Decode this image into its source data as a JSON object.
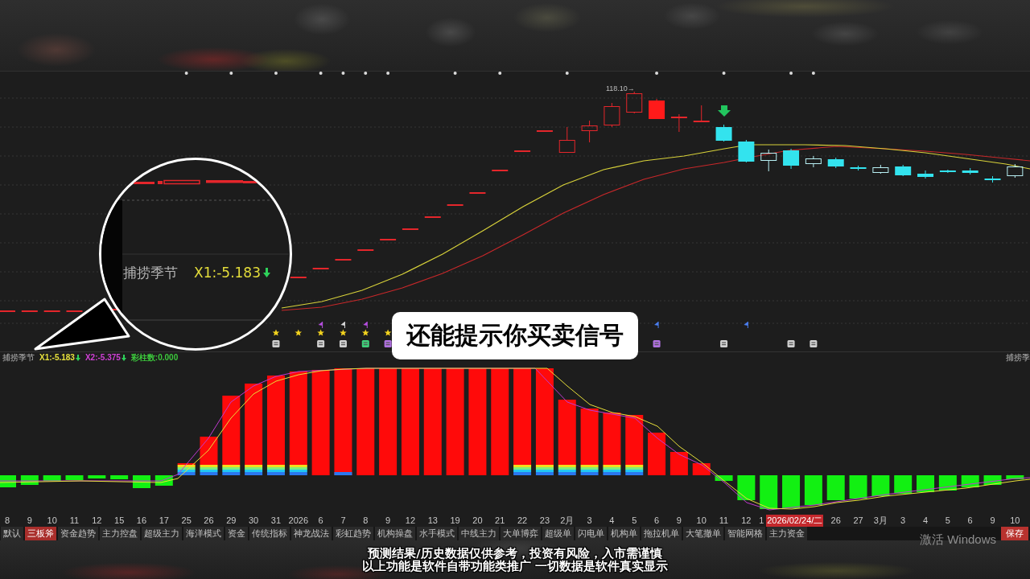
{
  "price_chart": {
    "high_label": "118.10→"
  },
  "magnifier": {
    "indicator_name": "捕捞季节",
    "x1_reading": "X1:-5.183"
  },
  "callout": {
    "text": "还能提示你买卖信号"
  },
  "indicator_bar": {
    "name": "捕捞季节",
    "readings": [
      {
        "text": "X1:-5.183",
        "color": "#e6e03c",
        "arrow": true
      },
      {
        "text": "X2:-5.375",
        "color": "#d040d6",
        "arrow": true
      },
      {
        "text": "彩柱数:0.000",
        "color": "#3cc83c",
        "arrow": false
      }
    ],
    "right_label": "捕捞季"
  },
  "date_axis": [
    {
      "label": "8",
      "kind": "date"
    },
    {
      "label": "9",
      "kind": "date"
    },
    {
      "label": "10",
      "kind": "date"
    },
    {
      "label": "11",
      "kind": "date"
    },
    {
      "label": "12",
      "kind": "date"
    },
    {
      "label": "15",
      "kind": "date"
    },
    {
      "label": "16",
      "kind": "date"
    },
    {
      "label": "17",
      "kind": "date"
    },
    {
      "label": "25",
      "kind": "date"
    },
    {
      "label": "26",
      "kind": "date"
    },
    {
      "label": "29",
      "kind": "date"
    },
    {
      "label": "30",
      "kind": "date"
    },
    {
      "label": "31",
      "kind": "date"
    },
    {
      "label": "2026",
      "kind": "date"
    },
    {
      "label": "6",
      "kind": "date"
    },
    {
      "label": "7",
      "kind": "date"
    },
    {
      "label": "8",
      "kind": "date"
    },
    {
      "label": "9",
      "kind": "date"
    },
    {
      "label": "12",
      "kind": "date"
    },
    {
      "label": "13",
      "kind": "date"
    },
    {
      "label": "19",
      "kind": "date"
    },
    {
      "label": "20",
      "kind": "date"
    },
    {
      "label": "21",
      "kind": "date"
    },
    {
      "label": "22",
      "kind": "date"
    },
    {
      "label": "23",
      "kind": "date"
    },
    {
      "label": "2月",
      "kind": "date"
    },
    {
      "label": "3",
      "kind": "date"
    },
    {
      "label": "4",
      "kind": "date"
    },
    {
      "label": "5",
      "kind": "date"
    },
    {
      "label": "6",
      "kind": "date"
    },
    {
      "label": "9",
      "kind": "date"
    },
    {
      "label": "10",
      "kind": "date"
    },
    {
      "label": "11",
      "kind": "date"
    },
    {
      "label": "12",
      "kind": "date"
    },
    {
      "label": "1",
      "kind": "clipped"
    },
    {
      "label": "2026/02/24/二",
      "kind": "cursor"
    },
    {
      "label": "26",
      "kind": "date"
    },
    {
      "label": "27",
      "kind": "date"
    },
    {
      "label": "3月",
      "kind": "date"
    },
    {
      "label": "3",
      "kind": "date"
    },
    {
      "label": "4",
      "kind": "date"
    },
    {
      "label": "5",
      "kind": "date"
    },
    {
      "label": "6",
      "kind": "date"
    },
    {
      "label": "9",
      "kind": "date"
    },
    {
      "label": "10",
      "kind": "date"
    }
  ],
  "tabs": [
    {
      "label": "默认",
      "selected": false
    },
    {
      "label": "三板斧",
      "selected": true
    },
    {
      "label": "资金趋势",
      "selected": false
    },
    {
      "label": "主力控盘",
      "selected": false
    },
    {
      "label": "超级主力",
      "selected": false
    },
    {
      "label": "海洋模式",
      "selected": false
    },
    {
      "label": "资金",
      "selected": false
    },
    {
      "label": "传统指标",
      "selected": false
    },
    {
      "label": "神龙战法",
      "selected": false
    },
    {
      "label": "彩虹趋势",
      "selected": false
    },
    {
      "label": "机构操盘",
      "selected": false
    },
    {
      "label": "水手模式",
      "selected": false
    },
    {
      "label": "中线主力",
      "selected": false
    },
    {
      "label": "大单博弈",
      "selected": false
    },
    {
      "label": "超级单",
      "selected": false
    },
    {
      "label": "闪电单",
      "selected": false
    },
    {
      "label": "机构单",
      "selected": false
    },
    {
      "label": "拖拉机单",
      "selected": false
    },
    {
      "label": "大笔撤单",
      "selected": false
    },
    {
      "label": "智能网格",
      "selected": false
    },
    {
      "label": "主力资金",
      "selected": false
    }
  ],
  "save_button": {
    "label": "保存"
  },
  "activation_notice": "激活 Windows",
  "disclaimer": [
    "预测结果/历史数据仅供参考，投资有风险，入市需谨慎",
    "以上功能是软件自带功能类推广 一切数据是软件真实显示"
  ]
}
